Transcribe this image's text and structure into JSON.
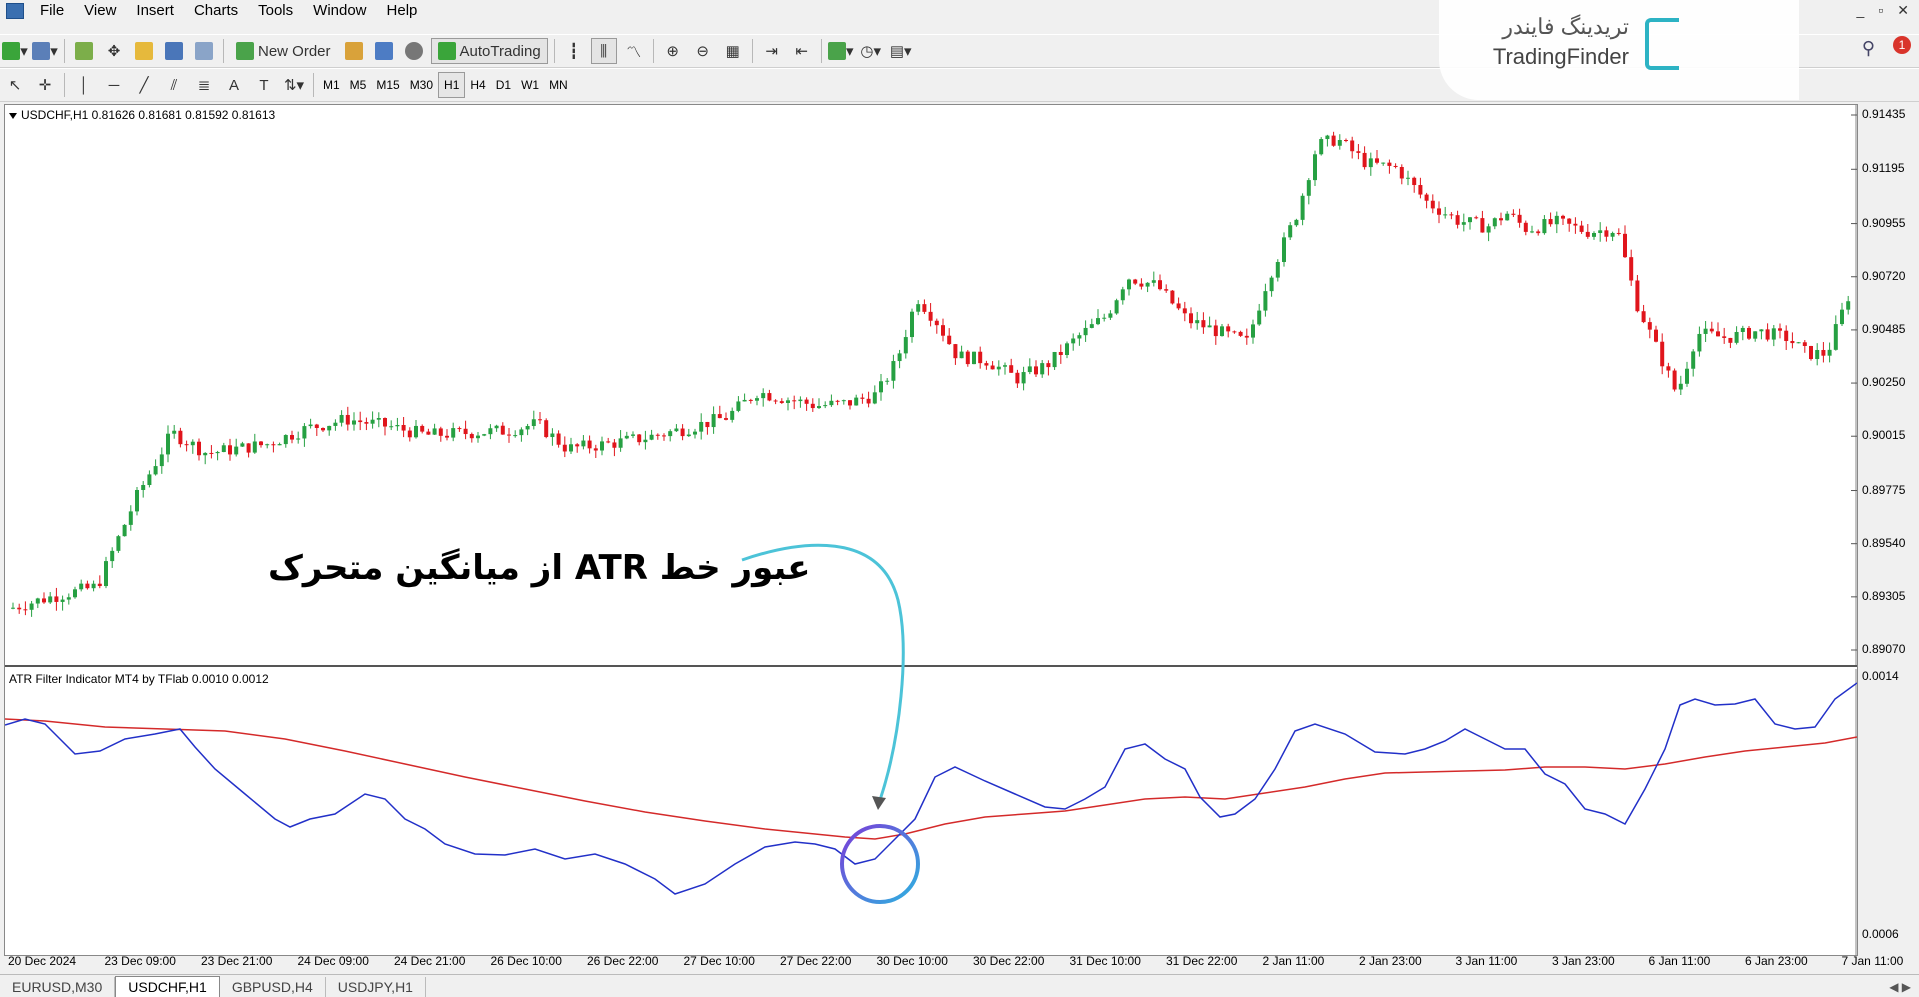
{
  "menu": {
    "items": [
      "File",
      "View",
      "Insert",
      "Charts",
      "Tools",
      "Window",
      "Help"
    ]
  },
  "toolbar": {
    "new_order_label": "New Order",
    "autotrading_label": "AutoTrading"
  },
  "timeframes": [
    "M1",
    "M5",
    "M15",
    "M30",
    "H1",
    "H4",
    "D1",
    "W1",
    "MN"
  ],
  "active_timeframe": "H1",
  "logo": {
    "fa": "تریدینگ فایندر",
    "en": "TradingFinder",
    "color": "#2db3c4"
  },
  "notification_count": "1",
  "main_chart": {
    "title": "USDCHF,H1  0.81626 0.81681 0.81592 0.81613",
    "price_ticks": [
      "0.91435",
      "0.91195",
      "0.90955",
      "0.90720",
      "0.90485",
      "0.90250",
      "0.90015",
      "0.89775",
      "0.89540",
      "0.89305",
      "0.89070"
    ],
    "bull_color": "#26a042",
    "bear_color": "#e0151c"
  },
  "indicator": {
    "title": "ATR Filter Indicator MT4 by TFlab 0.0010 0.0012",
    "ticks": [
      "0.0014",
      "0.0006"
    ],
    "atr_color": "#2230c8",
    "ma_color": "#d42a2a"
  },
  "time_axis": [
    "20 Dec 2024",
    "23 Dec 09:00",
    "23 Dec 21:00",
    "24 Dec 09:00",
    "24 Dec 21:00",
    "26 Dec 10:00",
    "26 Dec 22:00",
    "27 Dec 10:00",
    "27 Dec 22:00",
    "30 Dec 10:00",
    "30 Dec 22:00",
    "31 Dec 10:00",
    "31 Dec 22:00",
    "2 Jan 11:00",
    "2 Jan 23:00",
    "3 Jan 11:00",
    "3 Jan 23:00",
    "6 Jan 11:00",
    "6 Jan 23:00",
    "7 Jan 11:00"
  ],
  "annotation": {
    "text": "عبور خط ATR از میانگین متحرک",
    "arrow_color": "#4cc3d8"
  },
  "tabs": [
    "EURUSD,M30",
    "USDCHF,H1",
    "GBPUSD,H4",
    "USDJPY,H1"
  ],
  "active_tab": "USDCHF,H1"
}
